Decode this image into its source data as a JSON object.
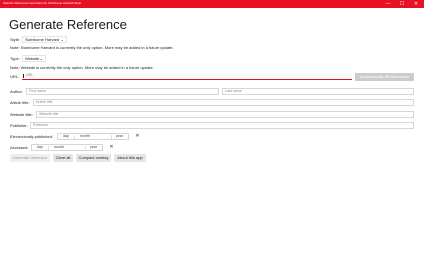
{
  "window": {
    "title": "Website Reference Generator for Swinburne Harvard Style",
    "minimize_glyph": "—",
    "maximize_glyph": "☐",
    "close_glyph": "✕"
  },
  "heading": "Generate Reference",
  "style": {
    "label": "Style:",
    "value": "Swinburne Harvard",
    "chevron": "⌄"
  },
  "style_note": "Note: Swinburne Harvard is currently the only option. More may be added in a future update.",
  "type": {
    "label": "Type:",
    "value": "Website",
    "chevron": "⌄"
  },
  "type_note": "Note: Website is currently the only option. More may be added in a future update.",
  "url": {
    "label": "URL:",
    "placeholder": "URL",
    "button": "Automatically fill information"
  },
  "author": {
    "label": "Author:",
    "first_placeholder": "First name",
    "last_placeholder": "Last name"
  },
  "article_title": {
    "label": "Article title:",
    "placeholder": "Article title"
  },
  "website_title": {
    "label": "Website title:",
    "placeholder": "Website title"
  },
  "publisher": {
    "label": "Publisher:",
    "placeholder": "Publisher"
  },
  "published": {
    "label": "Electronically published:",
    "day": "day",
    "month": "month",
    "year": "year",
    "clear_glyph": "✕"
  },
  "accessed": {
    "label": "Accessed:",
    "day": "day",
    "month": "month",
    "year": "year",
    "clear_glyph": "✕"
  },
  "actions": {
    "generate": "Generate reference",
    "clear": "Clear all",
    "compact": "Compact overlay",
    "about": "About this app"
  },
  "colors": {
    "accent": "#e81123"
  }
}
